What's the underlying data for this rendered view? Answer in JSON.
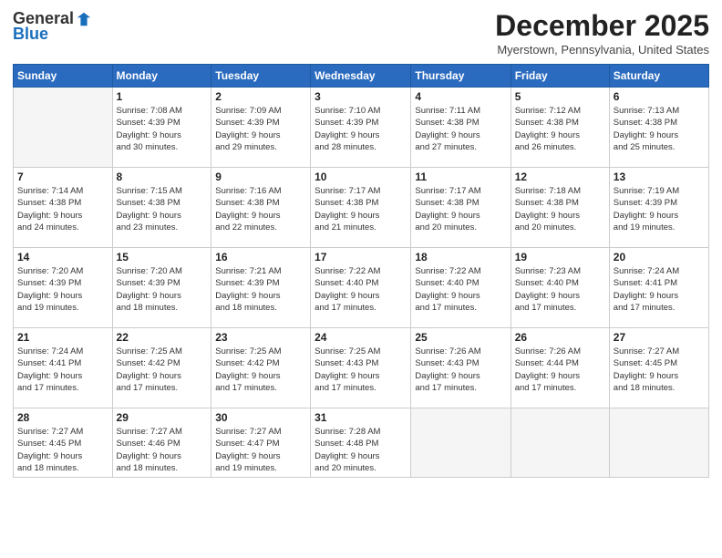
{
  "logo": {
    "general": "General",
    "blue": "Blue"
  },
  "header": {
    "month": "December 2025",
    "location": "Myerstown, Pennsylvania, United States"
  },
  "weekdays": [
    "Sunday",
    "Monday",
    "Tuesday",
    "Wednesday",
    "Thursday",
    "Friday",
    "Saturday"
  ],
  "weeks": [
    [
      {
        "day": "",
        "info": ""
      },
      {
        "day": "1",
        "info": "Sunrise: 7:08 AM\nSunset: 4:39 PM\nDaylight: 9 hours\nand 30 minutes."
      },
      {
        "day": "2",
        "info": "Sunrise: 7:09 AM\nSunset: 4:39 PM\nDaylight: 9 hours\nand 29 minutes."
      },
      {
        "day": "3",
        "info": "Sunrise: 7:10 AM\nSunset: 4:39 PM\nDaylight: 9 hours\nand 28 minutes."
      },
      {
        "day": "4",
        "info": "Sunrise: 7:11 AM\nSunset: 4:38 PM\nDaylight: 9 hours\nand 27 minutes."
      },
      {
        "day": "5",
        "info": "Sunrise: 7:12 AM\nSunset: 4:38 PM\nDaylight: 9 hours\nand 26 minutes."
      },
      {
        "day": "6",
        "info": "Sunrise: 7:13 AM\nSunset: 4:38 PM\nDaylight: 9 hours\nand 25 minutes."
      }
    ],
    [
      {
        "day": "7",
        "info": "Sunrise: 7:14 AM\nSunset: 4:38 PM\nDaylight: 9 hours\nand 24 minutes."
      },
      {
        "day": "8",
        "info": "Sunrise: 7:15 AM\nSunset: 4:38 PM\nDaylight: 9 hours\nand 23 minutes."
      },
      {
        "day": "9",
        "info": "Sunrise: 7:16 AM\nSunset: 4:38 PM\nDaylight: 9 hours\nand 22 minutes."
      },
      {
        "day": "10",
        "info": "Sunrise: 7:17 AM\nSunset: 4:38 PM\nDaylight: 9 hours\nand 21 minutes."
      },
      {
        "day": "11",
        "info": "Sunrise: 7:17 AM\nSunset: 4:38 PM\nDaylight: 9 hours\nand 20 minutes."
      },
      {
        "day": "12",
        "info": "Sunrise: 7:18 AM\nSunset: 4:38 PM\nDaylight: 9 hours\nand 20 minutes."
      },
      {
        "day": "13",
        "info": "Sunrise: 7:19 AM\nSunset: 4:39 PM\nDaylight: 9 hours\nand 19 minutes."
      }
    ],
    [
      {
        "day": "14",
        "info": "Sunrise: 7:20 AM\nSunset: 4:39 PM\nDaylight: 9 hours\nand 19 minutes."
      },
      {
        "day": "15",
        "info": "Sunrise: 7:20 AM\nSunset: 4:39 PM\nDaylight: 9 hours\nand 18 minutes."
      },
      {
        "day": "16",
        "info": "Sunrise: 7:21 AM\nSunset: 4:39 PM\nDaylight: 9 hours\nand 18 minutes."
      },
      {
        "day": "17",
        "info": "Sunrise: 7:22 AM\nSunset: 4:40 PM\nDaylight: 9 hours\nand 17 minutes."
      },
      {
        "day": "18",
        "info": "Sunrise: 7:22 AM\nSunset: 4:40 PM\nDaylight: 9 hours\nand 17 minutes."
      },
      {
        "day": "19",
        "info": "Sunrise: 7:23 AM\nSunset: 4:40 PM\nDaylight: 9 hours\nand 17 minutes."
      },
      {
        "day": "20",
        "info": "Sunrise: 7:24 AM\nSunset: 4:41 PM\nDaylight: 9 hours\nand 17 minutes."
      }
    ],
    [
      {
        "day": "21",
        "info": "Sunrise: 7:24 AM\nSunset: 4:41 PM\nDaylight: 9 hours\nand 17 minutes."
      },
      {
        "day": "22",
        "info": "Sunrise: 7:25 AM\nSunset: 4:42 PM\nDaylight: 9 hours\nand 17 minutes."
      },
      {
        "day": "23",
        "info": "Sunrise: 7:25 AM\nSunset: 4:42 PM\nDaylight: 9 hours\nand 17 minutes."
      },
      {
        "day": "24",
        "info": "Sunrise: 7:25 AM\nSunset: 4:43 PM\nDaylight: 9 hours\nand 17 minutes."
      },
      {
        "day": "25",
        "info": "Sunrise: 7:26 AM\nSunset: 4:43 PM\nDaylight: 9 hours\nand 17 minutes."
      },
      {
        "day": "26",
        "info": "Sunrise: 7:26 AM\nSunset: 4:44 PM\nDaylight: 9 hours\nand 17 minutes."
      },
      {
        "day": "27",
        "info": "Sunrise: 7:27 AM\nSunset: 4:45 PM\nDaylight: 9 hours\nand 18 minutes."
      }
    ],
    [
      {
        "day": "28",
        "info": "Sunrise: 7:27 AM\nSunset: 4:45 PM\nDaylight: 9 hours\nand 18 minutes."
      },
      {
        "day": "29",
        "info": "Sunrise: 7:27 AM\nSunset: 4:46 PM\nDaylight: 9 hours\nand 18 minutes."
      },
      {
        "day": "30",
        "info": "Sunrise: 7:27 AM\nSunset: 4:47 PM\nDaylight: 9 hours\nand 19 minutes."
      },
      {
        "day": "31",
        "info": "Sunrise: 7:28 AM\nSunset: 4:48 PM\nDaylight: 9 hours\nand 20 minutes."
      },
      {
        "day": "",
        "info": ""
      },
      {
        "day": "",
        "info": ""
      },
      {
        "day": "",
        "info": ""
      }
    ]
  ]
}
